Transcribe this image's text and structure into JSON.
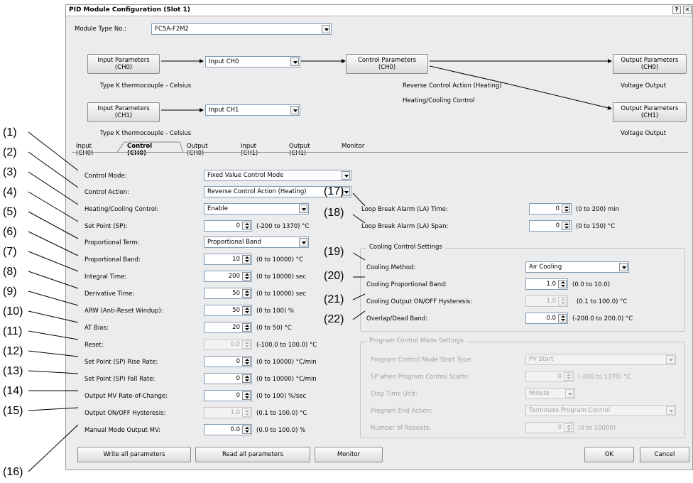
{
  "window": {
    "title": "PID Module Configuration (Slot 1)",
    "help_btn": "?",
    "close_btn": "✕"
  },
  "module_type": {
    "label": "Module Type No.:",
    "value": "FC5A-F2M2"
  },
  "flow": {
    "input_params_ch0": "Input Parameters\n(CH0)",
    "input_params_ch1": "Input Parameters\n(CH1)",
    "input_ch0_select": "Input CH0",
    "input_ch1_select": "Input CH1",
    "control_params_ch0": "Control Parameters\n(CH0)",
    "output_params_ch0": "Output Parameters\n(CH0)",
    "output_params_ch1": "Output Parameters\n(CH1)",
    "type_ch0": "Type K thermocouple - Celsius",
    "type_ch1": "Type K thermocouple - Celsius",
    "reverse_action": "Reverse Control Action (Heating)",
    "heating_cooling": "Heating/Cooling Control",
    "voltage_ch0": "Voltage Output",
    "voltage_ch1": "Voltage Output"
  },
  "tabs": [
    "Input (CH0)",
    "Control (CH0)",
    "Output (CH0)",
    "Input (CH1)",
    "Output (CH1)",
    "Monitor"
  ],
  "left": {
    "control_mode": {
      "label": "Control Mode:",
      "value": "Fixed Value Control Mode"
    },
    "control_action": {
      "label": "Control Action:",
      "value": "Reverse Control Action (Heating)"
    },
    "heating_cooling": {
      "label": "Heating/Cooling Control:",
      "value": "Enable"
    },
    "set_point": {
      "label": "Set Point (SP):",
      "value": "0",
      "range": "(-200 to 1370) °C"
    },
    "prop_term": {
      "label": "Proportional Term:",
      "value": "Proportional Band"
    },
    "prop_band": {
      "label": "Proportional Band:",
      "value": "10",
      "range": "(0 to 10000) °C"
    },
    "integral": {
      "label": "Integral Time:",
      "value": "200",
      "range": "(0 to 10000) sec"
    },
    "derivative": {
      "label": "Derivative Time:",
      "value": "50",
      "range": "(0 to 10000) sec"
    },
    "arw": {
      "label": "ARW (Anti-Reset Windup):",
      "value": "50",
      "range": "(0 to 100) %"
    },
    "at_bias": {
      "label": "AT Bias:",
      "value": "20",
      "range": "(0 to 50) °C"
    },
    "reset": {
      "label": "Reset:",
      "value": "0.0",
      "range": "(-100.0 to 100.0) °C"
    },
    "sp_rise": {
      "label": "Set Point (SP) Rise Rate:",
      "value": "0",
      "range": "(0 to 10000) °C/min"
    },
    "sp_fall": {
      "label": "Set Point (SP) Fall Rate:",
      "value": "0",
      "range": "(0 to 10000) °C/min"
    },
    "mv_rate": {
      "label": "Output MV Rate-of-Change:",
      "value": "0",
      "range": "(0 to 100) %/sec"
    },
    "onoff_hyst": {
      "label": "Output ON/OFF Hysteresis:",
      "value": "1.0",
      "range": "(0.1 to 100.0) °C"
    },
    "manual_mv": {
      "label": "Manual Mode Output MV:",
      "value": "0.0",
      "range": "(0.0 to 100.0) %"
    }
  },
  "right": {
    "la_time": {
      "label": "Loop Break Alarm (LA) Time:",
      "value": "0",
      "range": "(0 to 200) min"
    },
    "la_span": {
      "label": "Loop Break Alarm (LA) Span:",
      "value": "0",
      "range": "(0 to 150) °C"
    },
    "cooling_group": "Cooling Control Settings",
    "cooling_method": {
      "label": "Cooling Method:",
      "value": "Air Cooling"
    },
    "cooling_band": {
      "label": "Cooling Proportional Band:",
      "value": "1.0",
      "range": "(0.0 to 10.0)"
    },
    "cooling_hyst": {
      "label": "Cooling Output ON/OFF Hysteresis:",
      "value": "1.0",
      "range": "(0.1 to 100.0) °C"
    },
    "overlap": {
      "label": "Overlap/Dead Band:",
      "value": "0.0",
      "range": "(-200.0 to 200.0) °C"
    },
    "program_group": "Program Control Mode Settings",
    "prog_start": {
      "label": "Program Control Mode Start Type:",
      "value": "PV Start"
    },
    "sp_prog": {
      "label": "SP when Program Control Starts:",
      "value": "0",
      "range": "(-200 to 1370) °C"
    },
    "step_unit": {
      "label": "Step Time Unit:",
      "value": "Minute"
    },
    "prog_end": {
      "label": "Program End Action:",
      "value": "Terminate Program Control"
    },
    "repeats": {
      "label": "Number of Repeats:",
      "value": "0",
      "range": "(0 to 10000)"
    }
  },
  "buttons": {
    "write": "Write all parameters",
    "read": "Read all parameters",
    "monitor": "Monitor",
    "ok": "OK",
    "cancel": "Cancel"
  },
  "callouts": [
    "(1)",
    "(2)",
    "(3)",
    "(4)",
    "(5)",
    "(6)",
    "(7)",
    "(8)",
    "(9)",
    "(10)",
    "(11)",
    "(12)",
    "(13)",
    "(14)",
    "(15)",
    "(16)",
    "(17)",
    "(18)",
    "(19)",
    "(20)",
    "(21)",
    "(22)"
  ],
  "colors": {
    "window_bg": "#ececec",
    "field_border": "#7f9db9",
    "disabled_text": "#a3a3a3"
  }
}
